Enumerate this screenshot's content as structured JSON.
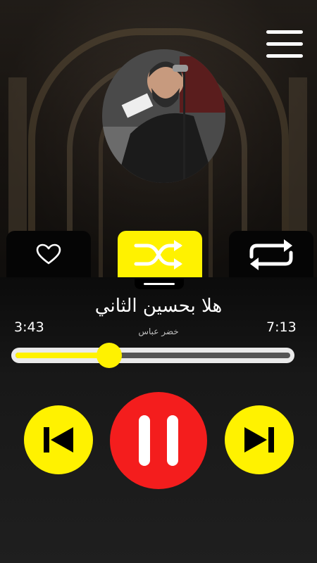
{
  "app": {
    "accent": "#fff200",
    "pause_color": "#f41d1d"
  },
  "header": {
    "menu_icon": "hamburger-menu-icon"
  },
  "tabs": [
    {
      "icon": "heart-icon"
    },
    {
      "icon": "shuffle-icon"
    },
    {
      "icon": "repeat-icon"
    }
  ],
  "track": {
    "title": "هلا بحسين الثاني",
    "artist": "خضر عباس",
    "current_time": "3:43",
    "total_time": "7:13",
    "progress": 0.34
  },
  "controls": {
    "previous_icon": "skip-previous-icon",
    "pause_icon": "pause-icon",
    "next_icon": "skip-next-icon"
  }
}
